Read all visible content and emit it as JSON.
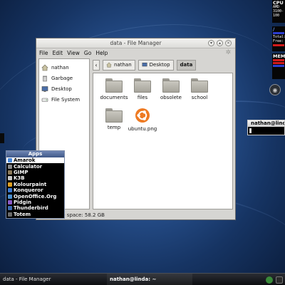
{
  "window": {
    "title": "data - File Manager",
    "menu": [
      "File",
      "Edit",
      "View",
      "Go",
      "Help"
    ],
    "places": [
      {
        "label": "nathan",
        "icon": "home-icon"
      },
      {
        "label": "Garbage",
        "icon": "trash-icon"
      },
      {
        "label": "Desktop",
        "icon": "desktop-icon"
      },
      {
        "label": "File System",
        "icon": "drive-icon"
      }
    ],
    "path": [
      "nathan",
      "Desktop",
      "data"
    ],
    "files": [
      {
        "label": "documents",
        "type": "folder"
      },
      {
        "label": "files",
        "type": "folder"
      },
      {
        "label": "obsolete",
        "type": "folder"
      },
      {
        "label": "school",
        "type": "folder"
      },
      {
        "label": "temp",
        "type": "folder"
      },
      {
        "label": "ubuntu.png",
        "type": "image"
      }
    ],
    "status": "1 kB), Free space: 58.2 GB"
  },
  "apps_menu": {
    "title": "Apps",
    "items": [
      {
        "label": "Amarok",
        "color": "#4a88d8"
      },
      {
        "label": "Calculator",
        "color": "#8a8a8a"
      },
      {
        "label": "GIMP",
        "color": "#8c7a5a"
      },
      {
        "label": "K3B",
        "color": "#c8c8c8"
      },
      {
        "label": "Kolourpaint",
        "color": "#e0a020"
      },
      {
        "label": "Konqueror",
        "color": "#3a78d0"
      },
      {
        "label": "OpenOffice.Org",
        "color": "#4a90d0"
      },
      {
        "label": "Pidgin",
        "color": "#8a5ac8"
      },
      {
        "label": "Thunderbird",
        "color": "#3a6ab0"
      },
      {
        "label": "Totem",
        "color": "#6a6a6a"
      }
    ],
    "selected": 0
  },
  "terminal": {
    "title": "nathan@lind"
  },
  "monitors": {
    "cpu_title": "CPU",
    "cpu_lines": [
      "AMD",
      "3100-",
      "100"
    ],
    "mem_root": "/",
    "mem_lines": [
      "Total:",
      "Free:"
    ],
    "mem_title": "MEM"
  },
  "taskbar": {
    "task1": "data - File Manager",
    "task2": "nathan@linda: ~"
  },
  "colors": {
    "accent": "#2c4f8c",
    "selection": "#ffffff",
    "monitor_bar": "#d21a1a"
  }
}
